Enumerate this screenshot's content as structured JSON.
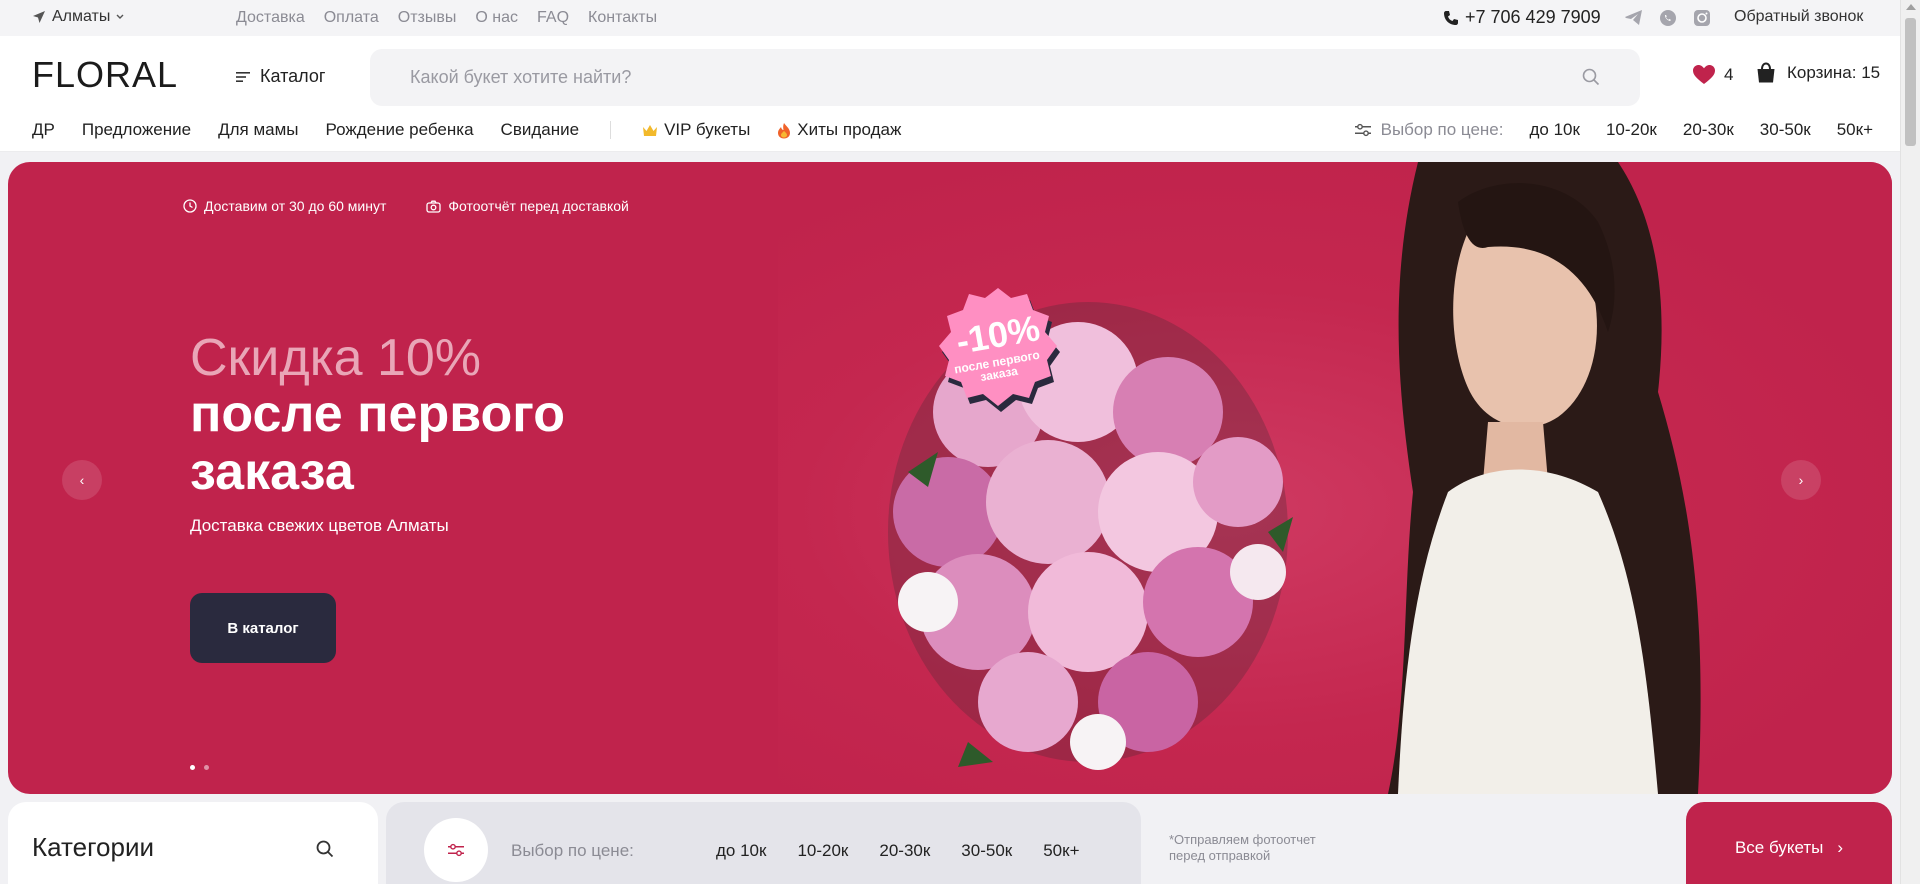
{
  "topbar": {
    "city": "Алматы",
    "links": [
      "Доставка",
      "Оплата",
      "Отзывы",
      "О нас",
      "FAQ",
      "Контакты"
    ],
    "phone": "+7 706 429 7909",
    "socials": [
      "telegram-icon",
      "whatsapp-icon",
      "instagram-icon"
    ],
    "callback": "Обратный звонок"
  },
  "header": {
    "logo": "FLORAL",
    "catalog": "Каталог",
    "search_placeholder": "Какой букет хотите найти?",
    "favorites_count": "4",
    "cart_label": "Корзина: 15"
  },
  "nav": {
    "items": [
      "ДР",
      "Предложение",
      "Для мамы",
      "Рождение ребенка",
      "Свидание"
    ],
    "vip": "VIP букеты",
    "hits": "Хиты продаж",
    "price_label": "Выбор по цене:",
    "price_options": [
      "до 10к",
      "10-20к",
      "20-30к",
      "30-50к",
      "50к+"
    ]
  },
  "hero": {
    "perk_delivery": "Доставим от 30 до 60 минут",
    "perk_photo": "Фотоотчёт перед доставкой",
    "title_light": "Скидка 10%",
    "title_bold": "после первого заказа",
    "subtitle": "Доставка свежих цветов Алматы",
    "cta": "В каталог",
    "badge_pct": "-10%",
    "badge_text": "после первого заказа",
    "slides": 2,
    "active_slide": 1,
    "colors": {
      "background": "#c0234c",
      "button": "#2a2a3e",
      "badge": "#ff8fc2"
    }
  },
  "bottom": {
    "categories_title": "Категории",
    "price_label": "Выбор по цене:",
    "price_options": [
      "до 10к",
      "10-20к",
      "20-30к",
      "30-50к",
      "50к+"
    ],
    "note": "*Отправляем фотоотчет перед отправкой",
    "all_bouquets": "Все букеты"
  }
}
